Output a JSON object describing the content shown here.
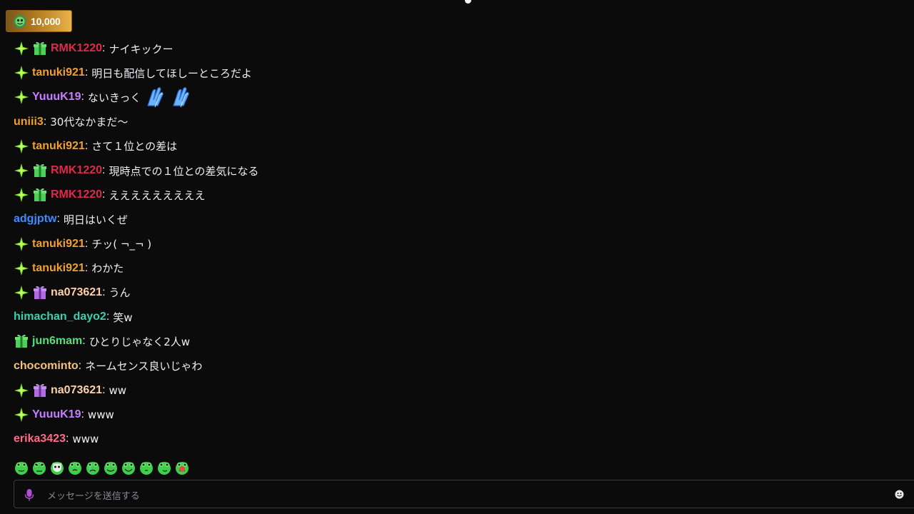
{
  "points": {
    "value": "10,000"
  },
  "colors": {
    "red": "#e0284a",
    "orange": "#f0a030",
    "purple": "#c77dff",
    "blue": "#3d8bff",
    "teal": "#3ccfb0",
    "green": "#54e07a",
    "tan": "#f3c37a",
    "pink": "#ff6a8a",
    "peach": "#ffd0a8"
  },
  "messages": [
    {
      "user": "RMK1220",
      "color": "#e0284a",
      "badges": [
        "star-badge",
        "gift-green-badge"
      ],
      "text": "ナイキックー"
    },
    {
      "user": "tanuki921",
      "color": "#f0a030",
      "badges": [
        "star-badge"
      ],
      "text": "明日も配信してほしーところだよ"
    },
    {
      "user": "YuuuK19",
      "color": "#c77dff",
      "badges": [
        "star-badge"
      ],
      "text": "ないきっく",
      "emotes": [
        "blue-hands-emote",
        "blue-hands-emote"
      ]
    },
    {
      "user": "uniii3",
      "color": "#f0a030",
      "badges": [],
      "text": "30代なかまだ〜"
    },
    {
      "user": "tanuki921",
      "color": "#f0a030",
      "badges": [
        "star-badge"
      ],
      "text": "さて１位との差は"
    },
    {
      "user": "RMK1220",
      "color": "#e0284a",
      "badges": [
        "star-badge",
        "gift-green-badge"
      ],
      "text": "現時点での１位との差気になる"
    },
    {
      "user": "RMK1220",
      "color": "#e0284a",
      "badges": [
        "star-badge",
        "gift-green-badge"
      ],
      "text": "えええええええええ"
    },
    {
      "user": "adgjptw",
      "color": "#3d8bff",
      "badges": [],
      "text": "明日はいくぜ"
    },
    {
      "user": "tanuki921",
      "color": "#f0a030",
      "badges": [
        "star-badge"
      ],
      "text": "チッ( ¬_¬ )"
    },
    {
      "user": "tanuki921",
      "color": "#f0a030",
      "badges": [
        "star-badge"
      ],
      "text": "わかた"
    },
    {
      "user": "na073621",
      "color": "#ffd0a8",
      "badges": [
        "star-badge",
        "gift-purple-badge"
      ],
      "text": "うん"
    },
    {
      "user": "himachan_dayo2",
      "color": "#3ccfb0",
      "badges": [],
      "text": "笑w"
    },
    {
      "user": "jun6mam",
      "color": "#54e07a",
      "badges": [
        "gift-green-badge"
      ],
      "text": "ひとりじゃなく2人w"
    },
    {
      "user": "chocominto",
      "color": "#f3c37a",
      "badges": [],
      "text": "ネームセンス良いじゃわ"
    },
    {
      "user": "na073621",
      "color": "#ffd0a8",
      "badges": [
        "star-badge",
        "gift-purple-badge"
      ],
      "text": "ww"
    },
    {
      "user": "YuuuK19",
      "color": "#c77dff",
      "badges": [
        "star-badge"
      ],
      "text": "www"
    },
    {
      "user": "erika3423",
      "color": "#ff6a8a",
      "badges": [],
      "text": "www"
    }
  ],
  "separator": ":",
  "emote_bar": [
    "frog-emote",
    "frog-angry-emote",
    "frog-skull-emote",
    "frog-peek-emote",
    "frog-cry-emote",
    "frog-smile-emote",
    "frog-happy-emote",
    "frog-small-emote",
    "frog-side-emote",
    "frog-red-emote"
  ],
  "input": {
    "placeholder": "メッセージを送信する"
  }
}
